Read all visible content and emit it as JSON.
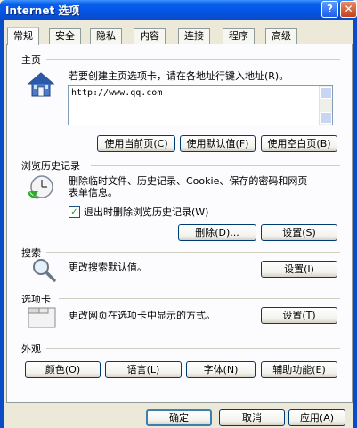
{
  "window": {
    "title": "Internet 选项",
    "help_label": "?",
    "close_label": "✕"
  },
  "tabs": [
    {
      "label": "常规"
    },
    {
      "label": "安全"
    },
    {
      "label": "隐私"
    },
    {
      "label": "内容"
    },
    {
      "label": "连接"
    },
    {
      "label": "程序"
    },
    {
      "label": "高级"
    }
  ],
  "home": {
    "group_label": "主页",
    "description": "若要创建主页选项卡，请在各地址行键入地址(R)。",
    "url_value": "http://www.qq.com",
    "buttons": {
      "current": "使用当前页(C)",
      "default": "使用默认值(F)",
      "blank": "使用空白页(B)"
    },
    "icon": "house-icon"
  },
  "history": {
    "group_label": "浏览历史记录",
    "description_line1": "删除临时文件、历史记录、Cookie、保存的密码和网页",
    "description_line2": "表单信息。",
    "checkbox_label": "退出时删除浏览历史记录(W)",
    "checkbox_checked": true,
    "buttons": {
      "delete": "删除(D)...",
      "settings": "设置(S)"
    },
    "icon": "history-clock-icon"
  },
  "search": {
    "group_label": "搜索",
    "description": "更改搜索默认值。",
    "buttons": {
      "settings": "设置(I)"
    },
    "icon": "magnifier-icon"
  },
  "tabbed": {
    "group_label": "选项卡",
    "description": "更改网页在选项卡中显示的方式。",
    "buttons": {
      "settings": "设置(T)"
    },
    "icon": "tabbed-window-icon"
  },
  "appearance": {
    "group_label": "外观",
    "buttons": {
      "colors": "颜色(O)",
      "languages": "语言(L)",
      "fonts": "字体(N)",
      "accessibility": "辅助功能(E)"
    }
  },
  "footer": {
    "ok": "确定",
    "cancel": "取消",
    "apply": "应用(A)"
  },
  "colors": {
    "titlebar": "#0454E3",
    "dialog_bg": "#ECE9D8",
    "active_tab_accent": "#FFC83C"
  }
}
